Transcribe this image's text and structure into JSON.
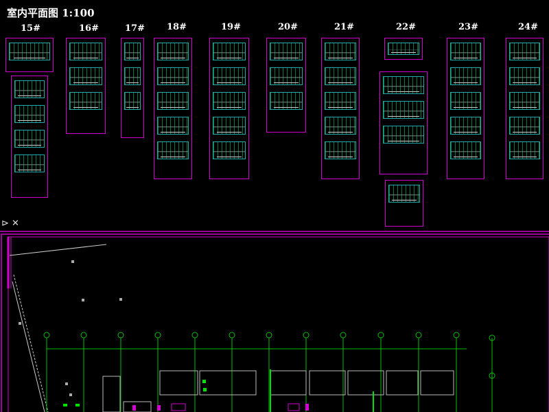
{
  "drawing": {
    "title": "室内平面图 1:100"
  },
  "buildings": [
    {
      "label": "15#"
    },
    {
      "label": "16#"
    },
    {
      "label": "17#"
    },
    {
      "label": "18#"
    },
    {
      "label": "19#"
    },
    {
      "label": "20#"
    },
    {
      "label": "21#"
    },
    {
      "label": "22#"
    },
    {
      "label": "23#"
    },
    {
      "label": "24#"
    }
  ],
  "ucs_icon": "axis-icon",
  "colors": {
    "background": "#000000",
    "frame": "#d000d0",
    "grid_line": "#00c000",
    "text": "#ffffff"
  }
}
